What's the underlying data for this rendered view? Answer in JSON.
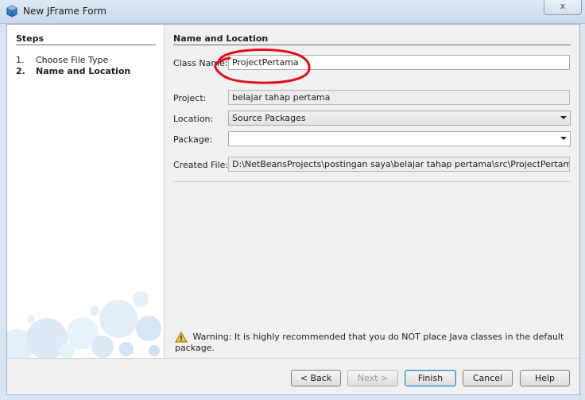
{
  "window": {
    "title": "New JFrame Form",
    "close_label": "x"
  },
  "steps": {
    "heading": "Steps",
    "items": [
      {
        "num": "1.",
        "label": "Choose File Type"
      },
      {
        "num": "2.",
        "label": "Name and Location"
      }
    ],
    "current_index": 1
  },
  "panel": {
    "heading": "Name and Location",
    "class_name": {
      "label": "Class Name:",
      "value": "ProjectPertama"
    },
    "project": {
      "label": "Project:",
      "value": "belajar tahap pertama"
    },
    "location": {
      "label": "Location:",
      "value": "Source Packages"
    },
    "package": {
      "label": "Package:",
      "value": ""
    },
    "created_file": {
      "label": "Created File:",
      "value": "D:\\NetBeansProjects\\postingan saya\\belajar tahap pertama\\src\\ProjectPertama.java"
    },
    "warning": "Warning: It is highly recommended that you do NOT place Java classes in the default package."
  },
  "buttons": {
    "back": "< Back",
    "next": "Next >",
    "finish": "Finish",
    "cancel": "Cancel",
    "help": "Help"
  },
  "colors": {
    "annotation": "#e0101a",
    "warning_icon": "#f4c430"
  }
}
